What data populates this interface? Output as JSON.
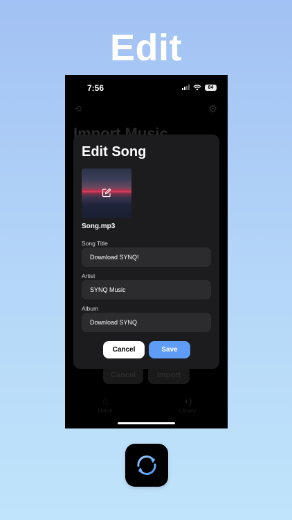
{
  "headline": "Edit",
  "status_bar": {
    "time": "7:56",
    "battery": "84"
  },
  "background_app": {
    "title": "Import Music",
    "cancel_label": "Cancel",
    "import_label": "Import",
    "tabs": [
      {
        "label": "Home",
        "icon": "house-icon"
      },
      {
        "label": "Library",
        "icon": "speaker-icon"
      }
    ]
  },
  "modal": {
    "title": "Edit Song",
    "filename": "Song.mp3",
    "fields": {
      "song_title": {
        "label": "Song Title",
        "value": "Download SYNQ!"
      },
      "artist": {
        "label": "Artist",
        "value": "SYNQ Music"
      },
      "album": {
        "label": "Album",
        "value": "Download SYNQ"
      }
    },
    "cancel_label": "Cancel",
    "save_label": "Save"
  },
  "colors": {
    "accent": "#5e9cf5",
    "modal_bg": "#1c1c1e",
    "field_bg": "#2c2c2e"
  },
  "app_icon": "synq-sync-arrows-icon"
}
